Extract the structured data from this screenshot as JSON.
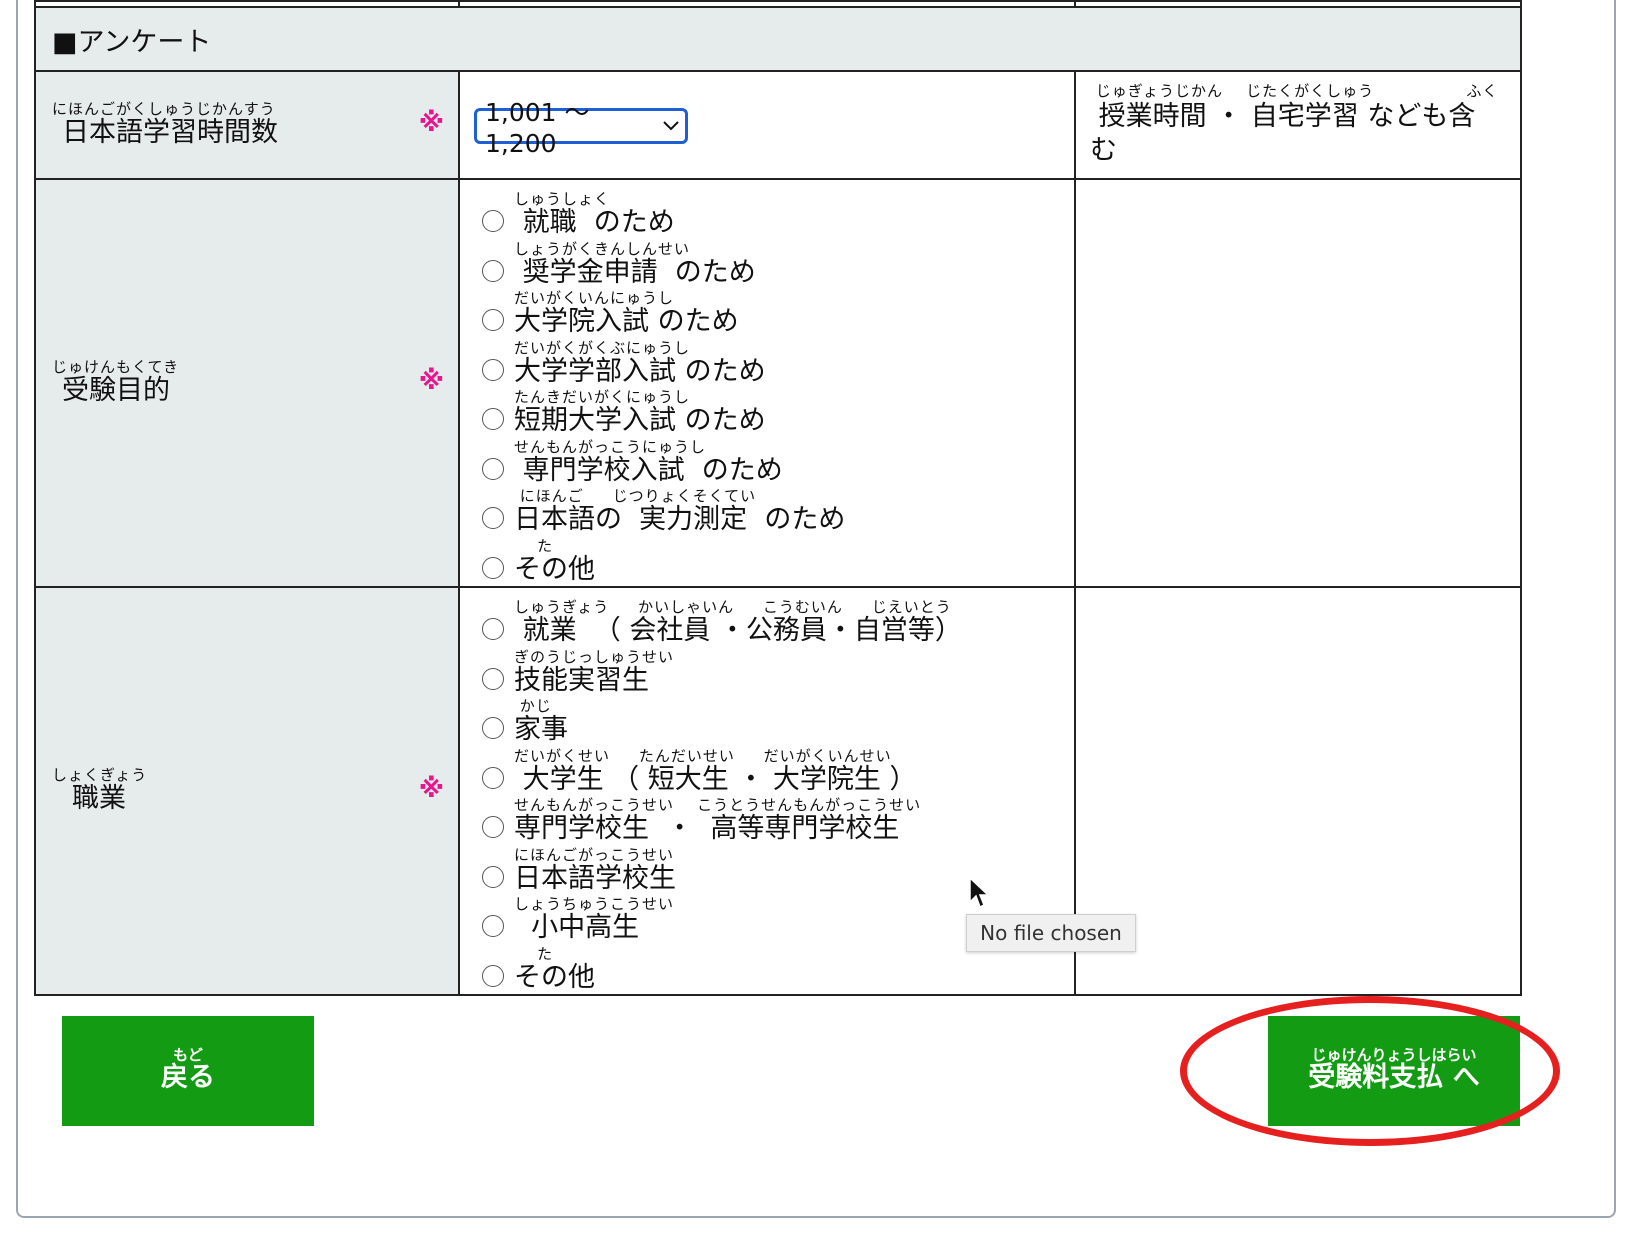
{
  "survey": {
    "section_title": "■アンケート",
    "study_hours": {
      "label_ruby": "にほんごがくしゅうじかんすう",
      "label": "日本語学習時間数",
      "required_mark": "※",
      "selected_value": "1,001 〜 1,200",
      "note_ruby": " じゅぎょうじかん    じたくがくしゅう                ふく",
      "note_line1": " 授業時間 ・ 自宅学習 なども含",
      "note_line2": "む"
    },
    "purpose": {
      "label_ruby": "じゅけんもくてき",
      "label": "受験目的",
      "required_mark": "※",
      "options": [
        {
          "ruby": "しゅうしょく",
          "text": " 就職  のため"
        },
        {
          "ruby": "しょうがくきんしんせい",
          "text": " 奨学金申請  のため"
        },
        {
          "ruby": "だいがくいんにゅうし",
          "text": "大学院入試 のため"
        },
        {
          "ruby": "だいがくがくぶにゅうし",
          "text": "大学学部入試 のため"
        },
        {
          "ruby": "たんきだいがくにゅうし",
          "text": "短期大学入試 のため"
        },
        {
          "ruby": "せんもんがっこうにゅうし",
          "text": " 専門学校入試  のため"
        },
        {
          "ruby": " にほんご     じつりょくそくてい",
          "text": "日本語の  実力測定  のため"
        },
        {
          "ruby": "    た",
          "text": "その他"
        }
      ]
    },
    "occupation": {
      "label_ruby": "しょくぎょう",
      "label": "職業",
      "required_mark": "※",
      "options": [
        {
          "ruby": "しゅうぎょう     かいしゃいん     こうむいん     じえいとう",
          "text": " 就業  （ 会社員 ・公務員・自営等）"
        },
        {
          "ruby": "ぎのうじっしゅうせい",
          "text": "技能実習生"
        },
        {
          "ruby": " かじ",
          "text": "家事"
        },
        {
          "ruby": "だいがくせい     たんだいせい     だいがくいんせい",
          "text": " 大学生 （ 短大生 ・ 大学院生 ）"
        },
        {
          "ruby": "せんもんがっこうせい    こうとうせんもんがっこうせい",
          "text": "専門学校生  ・  高等専門学校生"
        },
        {
          "ruby": "にほんごがっこうせい",
          "text": "日本語学校生"
        },
        {
          "ruby": "しょうちゅうこうせい",
          "text": "  小中高生"
        },
        {
          "ruby": "    た",
          "text": "その他"
        }
      ]
    }
  },
  "buttons": {
    "back": {
      "ruby": "もど",
      "label": "戻る"
    },
    "next": {
      "ruby": "じゅけんりょうしはらい",
      "label": "受験料支払 へ"
    }
  },
  "tooltip": "No file chosen",
  "colors": {
    "required": "#e8158e",
    "button": "#139c13",
    "annotation": "#e5201f",
    "label_bg": "#e6ebeb"
  }
}
